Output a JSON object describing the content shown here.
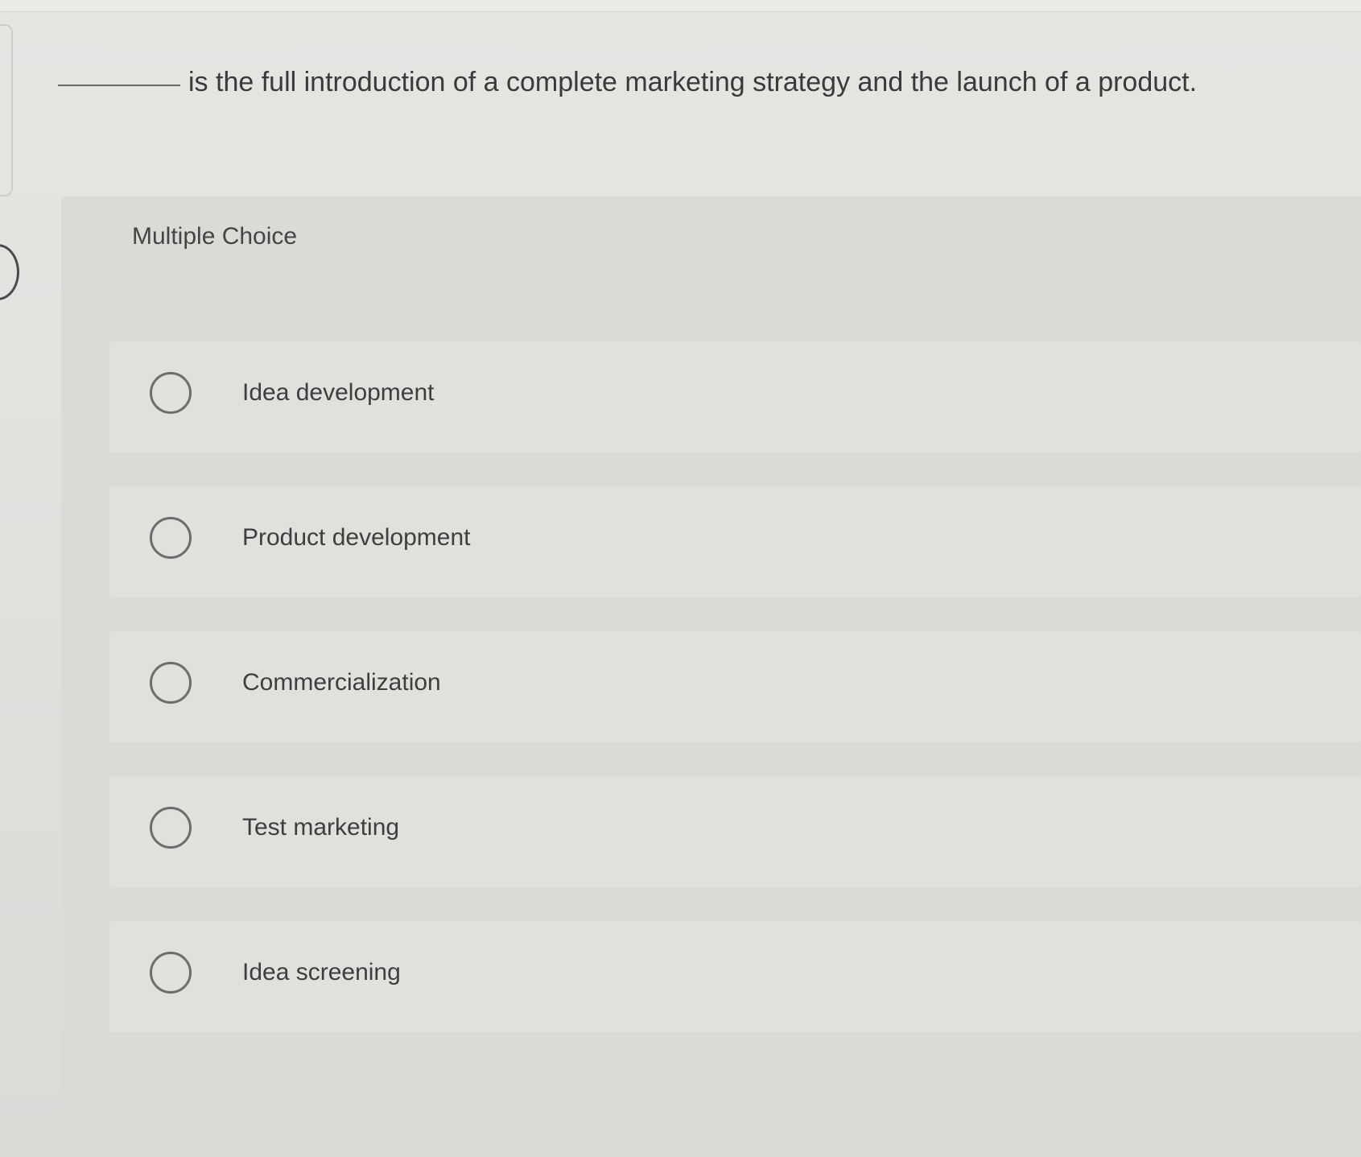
{
  "question": {
    "blank": "",
    "text": "is the full introduction of a complete marketing strategy and the launch of a product."
  },
  "panel": {
    "title": "Multiple Choice"
  },
  "options": [
    {
      "label": "Idea development"
    },
    {
      "label": "Product development"
    },
    {
      "label": "Commercialization"
    },
    {
      "label": "Test marketing"
    },
    {
      "label": "Idea screening"
    }
  ],
  "colors": {
    "background": "#e3e1de",
    "panel": "#dcdad7",
    "option_row": "#e2e0dd",
    "text": "#3e3e3e",
    "radio_border": "#6c6c6c"
  }
}
